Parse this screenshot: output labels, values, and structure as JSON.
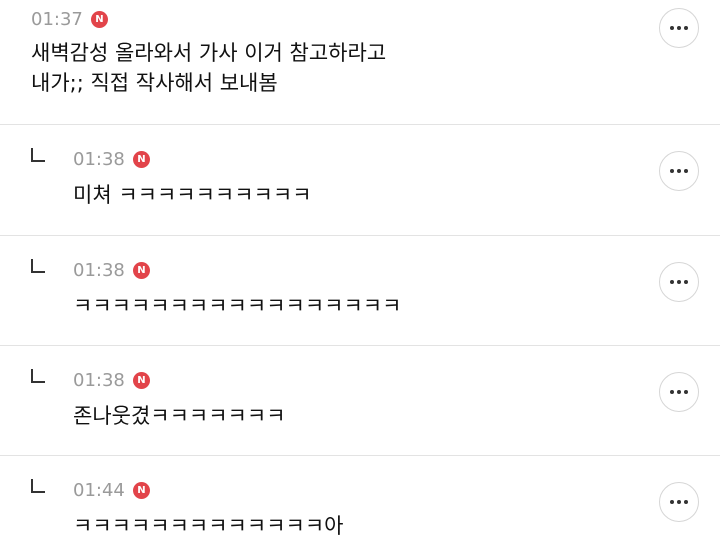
{
  "comments": [
    {
      "time": "01:37",
      "badge": "N",
      "text": "새벽감성 올라와서 가사 이거 참고하라고\n내가;; 직접 작사해서 보내봄",
      "is_reply": false
    },
    {
      "time": "01:38",
      "badge": "N",
      "text": "미쳐 ㅋㅋㅋㅋㅋㅋㅋㅋㅋㅋ",
      "is_reply": true
    },
    {
      "time": "01:38",
      "badge": "N",
      "text": "ㅋㅋㅋㅋㅋㅋㅋㅋㅋㅋㅋㅋㅋㅋㅋㅋㅋ",
      "is_reply": true
    },
    {
      "time": "01:38",
      "badge": "N",
      "text": "존나웃겼ㅋㅋㅋㅋㅋㅋㅋ",
      "is_reply": true
    },
    {
      "time": "01:44",
      "badge": "N",
      "text": "ㅋㅋㅋㅋㅋㅋㅋㅋㅋㅋㅋㅋㅋ아",
      "is_reply": true
    }
  ],
  "icons": {
    "reply": "reply-arrow-icon",
    "more": "more-options-icon",
    "badge": "new-badge-icon"
  }
}
